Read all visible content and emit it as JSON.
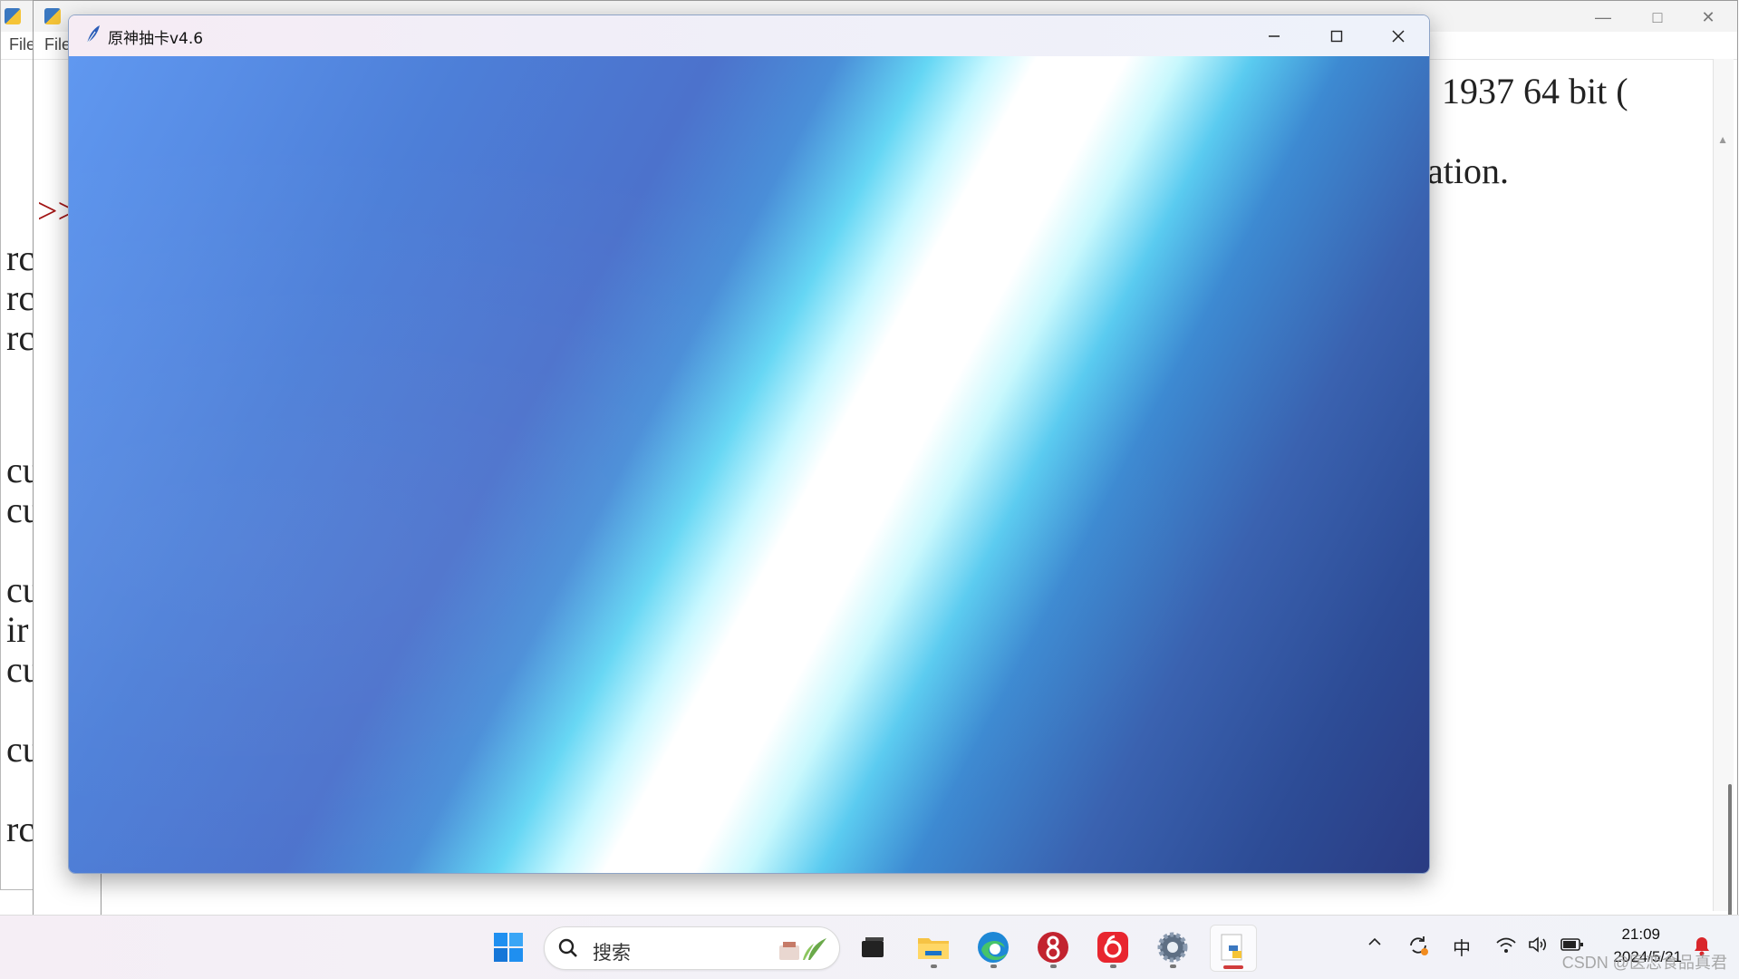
{
  "background_windows": {
    "menu_file": "File",
    "code_lines_right": [
      "1937 64 bit (",
      "ation."
    ],
    "prompt": ">>",
    "code_fragments_left": [
      "rc",
      "rc",
      "rc",
      "cu",
      "cu",
      "cu",
      "ir",
      "cu",
      "cu",
      "rc"
    ]
  },
  "main_window": {
    "title": "原神抽卡v4.6",
    "content_colors": [
      "#6098f0",
      "#4c72cc",
      "#ffffff",
      "#2a3b82"
    ]
  },
  "taskbar": {
    "search_placeholder": "搜索",
    "apps": [
      "start-icon",
      "search-widget-icon",
      "terminal-icon",
      "file-explorer-icon",
      "edge-icon",
      "app-8-icon",
      "netease-music-icon",
      "settings-icon",
      "python-idle-icon"
    ],
    "tray": {
      "chevron": "^",
      "ime": "中",
      "time": "21:09",
      "date": "2024/5/21"
    },
    "watermark": "CSDN @医恋食品真君"
  }
}
